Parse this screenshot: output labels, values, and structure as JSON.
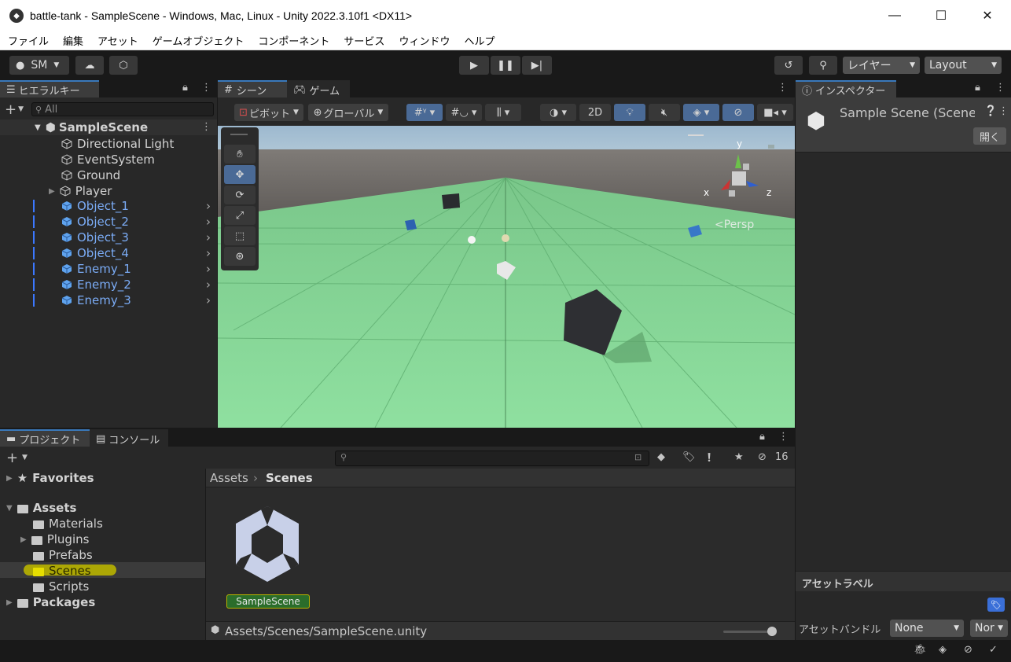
{
  "window": {
    "title": "battle-tank - SampleScene - Windows, Mac, Linux - Unity 2022.3.10f1 <DX11>"
  },
  "menu": [
    "ファイル",
    "編集",
    "アセット",
    "ゲームオブジェクト",
    "コンポーネント",
    "サービス",
    "ウィンドウ",
    "ヘルプ"
  ],
  "toolbar": {
    "account": "SM",
    "layers": "レイヤー",
    "layout": "Layout"
  },
  "hierarchy": {
    "tab": "ヒエラルキー",
    "search_placeholder": "All",
    "scene": "SampleScene",
    "items": [
      {
        "label": "Directional Light"
      },
      {
        "label": "EventSystem"
      },
      {
        "label": "Ground"
      },
      {
        "label": "Player"
      },
      {
        "label": "Object_1"
      },
      {
        "label": "Object_2"
      },
      {
        "label": "Object_3"
      },
      {
        "label": "Object_4"
      },
      {
        "label": "Enemy_1"
      },
      {
        "label": "Enemy_2"
      },
      {
        "label": "Enemy_3"
      }
    ]
  },
  "scene_view": {
    "tabs": [
      "シーン",
      "ゲーム"
    ],
    "pivot": "ピボット",
    "global": "グローバル",
    "mode_2d": "2D",
    "persp": "Persp",
    "gizmo_x": "x",
    "gizmo_y": "y",
    "gizmo_z": "z"
  },
  "inspector": {
    "tab": "インスペクター",
    "title": "Sample Scene (Scene",
    "open_button": "開く",
    "asset_labels": "アセットラベル",
    "asset_bundle_label": "アセットバンドル",
    "bundle_value": "None",
    "bundle_variant": "Nor"
  },
  "project": {
    "tabs": [
      "プロジェクト",
      "コンソール"
    ],
    "hidden_count": "16",
    "favorites": "Favorites",
    "assets": "Assets",
    "folders": [
      "Materials",
      "Plugins",
      "Prefabs",
      "Scenes",
      "Scripts"
    ],
    "packages": "Packages",
    "breadcrumb": [
      "Assets",
      "Scenes"
    ],
    "asset_name": "SampleScene",
    "path": "Assets/Scenes/SampleScene.unity"
  }
}
